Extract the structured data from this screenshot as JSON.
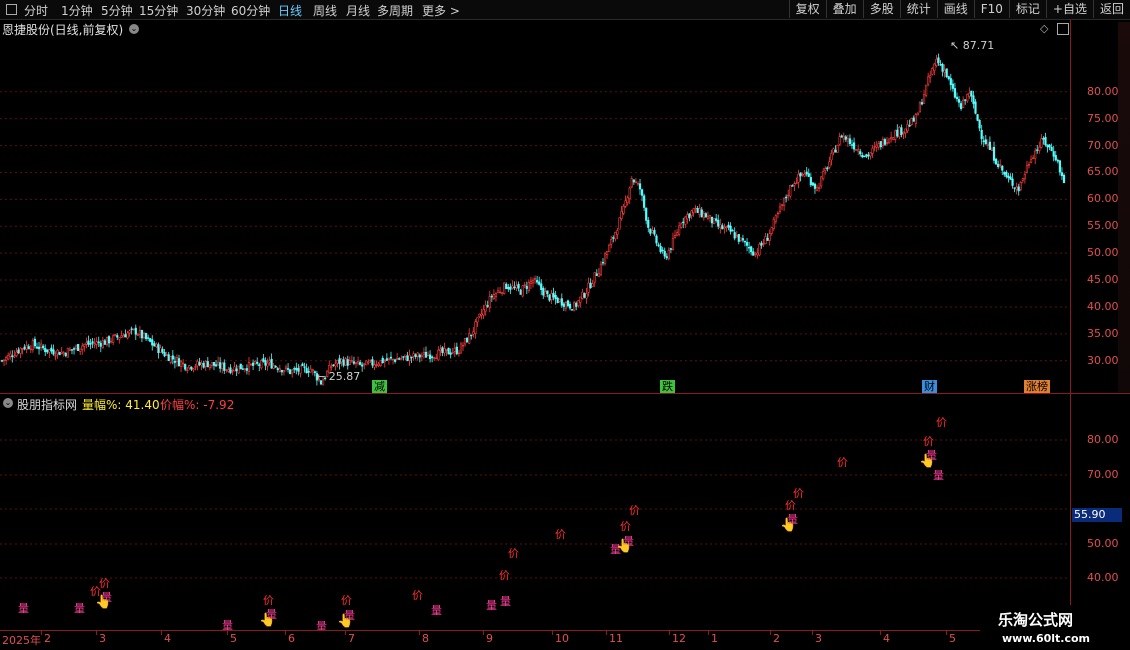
{
  "toolbar": {
    "periods": [
      "分时",
      "1分钟",
      "5分钟",
      "15分钟",
      "30分钟",
      "60分钟",
      "日线",
      "周线",
      "月线",
      "多周期",
      "更多 >"
    ],
    "active_period": "日线",
    "right_buttons": [
      "复权",
      "叠加",
      "多股",
      "统计",
      "画线",
      "F10",
      "标记",
      "+自选",
      "返回"
    ]
  },
  "main_chart": {
    "title": "恩捷股份(日线,前复权)",
    "high_marker": "87.71",
    "low_marker": "25.87",
    "event_tags": [
      {
        "text": "减",
        "color": "#3cc43c"
      },
      {
        "text": "跌",
        "color": "#3cc43c"
      },
      {
        "text": "财",
        "color": "#3a8ee0"
      },
      {
        "text": "涨榜",
        "color": "#e08030"
      }
    ],
    "y_ticks": [
      "80.00",
      "75.00",
      "70.00",
      "65.00",
      "60.00",
      "55.00",
      "50.00",
      "45.00",
      "40.00",
      "35.00",
      "30.00"
    ]
  },
  "indicator": {
    "title": "股朋指标网",
    "liang_label": "量幅%:",
    "liang_value": "41.40",
    "jia_label": "价幅%:",
    "jia_value": "-7.92",
    "liang_char": "量",
    "jia_char": "价",
    "y_ticks": [
      "80.00",
      "70.00",
      "50.00",
      "40.00"
    ],
    "current_price": "55.90",
    "hand_icon": "pointing-hand-icon"
  },
  "x_axis": {
    "labels": [
      "2025年",
      "2",
      "3",
      "4",
      "5",
      "6",
      "7",
      "8",
      "9",
      "10",
      "11",
      "12",
      "1",
      "2",
      "3",
      "4",
      "5"
    ]
  },
  "watermark": {
    "line1": "乐淘公式网",
    "line2": "www.60lt.com"
  },
  "chart_data": {
    "type": "candlestick",
    "title": "恩捷股份(日线,前复权)",
    "y_range": [
      24,
      90
    ],
    "x_labels": [
      "2025年",
      "2",
      "3",
      "4",
      "5",
      "6",
      "7",
      "8",
      "9",
      "10",
      "11",
      "12",
      "1",
      "2",
      "3",
      "4",
      "5"
    ],
    "approx_close_path": [
      [
        0,
        30
      ],
      [
        10,
        32.5
      ],
      [
        15,
        33
      ],
      [
        22,
        32
      ],
      [
        30,
        31.5
      ],
      [
        40,
        33
      ],
      [
        50,
        33.5
      ],
      [
        60,
        35
      ],
      [
        65,
        35.5
      ],
      [
        70,
        34
      ],
      [
        80,
        31
      ],
      [
        90,
        29
      ],
      [
        100,
        29.5
      ],
      [
        110,
        28.5
      ],
      [
        120,
        29
      ],
      [
        130,
        29.5
      ],
      [
        140,
        28
      ],
      [
        150,
        28.5
      ],
      [
        155,
        26
      ],
      [
        160,
        29
      ],
      [
        165,
        30
      ],
      [
        175,
        29
      ],
      [
        185,
        30
      ],
      [
        195,
        30.5
      ],
      [
        205,
        31
      ],
      [
        215,
        31.5
      ],
      [
        222,
        32
      ],
      [
        228,
        35
      ],
      [
        232,
        38
      ],
      [
        238,
        42
      ],
      [
        245,
        44
      ],
      [
        252,
        43
      ],
      [
        258,
        45
      ],
      [
        265,
        42
      ],
      [
        272,
        41
      ],
      [
        278,
        40
      ],
      [
        284,
        43
      ],
      [
        290,
        47
      ],
      [
        296,
        52
      ],
      [
        302,
        58
      ],
      [
        306,
        64
      ],
      [
        310,
        62
      ],
      [
        314,
        55
      ],
      [
        318,
        52
      ],
      [
        322,
        49
      ],
      [
        326,
        52
      ],
      [
        330,
        56
      ],
      [
        336,
        58
      ],
      [
        342,
        57
      ],
      [
        348,
        55
      ],
      [
        354,
        54
      ],
      [
        360,
        52
      ],
      [
        366,
        50
      ],
      [
        372,
        53
      ],
      [
        378,
        58
      ],
      [
        384,
        63
      ],
      [
        390,
        65
      ],
      [
        396,
        62
      ],
      [
        402,
        67
      ],
      [
        408,
        72
      ],
      [
        414,
        70
      ],
      [
        420,
        68
      ],
      [
        426,
        70
      ],
      [
        432,
        72
      ],
      [
        438,
        73
      ],
      [
        444,
        75
      ],
      [
        450,
        82
      ],
      [
        454,
        86
      ],
      [
        458,
        84
      ],
      [
        462,
        80
      ],
      [
        466,
        77
      ],
      [
        470,
        80
      ],
      [
        476,
        72
      ],
      [
        482,
        68
      ],
      [
        488,
        64
      ],
      [
        494,
        62
      ],
      [
        500,
        68
      ],
      [
        506,
        71
      ],
      [
        512,
        68
      ],
      [
        516,
        63
      ]
    ],
    "high": 87.71,
    "low": 25.87,
    "indicator_values": {
      "量幅%": 41.4,
      "价幅%": -7.92,
      "current_price": 55.9
    }
  }
}
